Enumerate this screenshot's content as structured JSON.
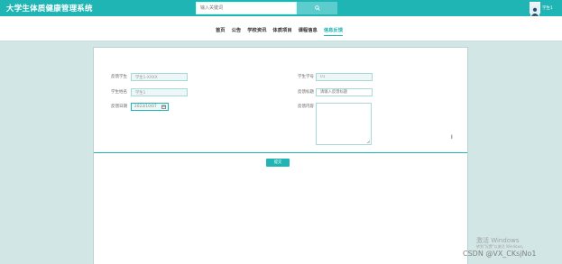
{
  "header": {
    "brand": "大学生体质健康管理系统",
    "search_placeholder": "输入关键词",
    "search_icon": "search-icon",
    "user_name": "学生1",
    "avatar_icon": "user-avatar-icon"
  },
  "nav": {
    "items": [
      {
        "label": "首页"
      },
      {
        "label": "公告"
      },
      {
        "label": "学校资讯"
      },
      {
        "label": "体质项目"
      },
      {
        "label": "课程信息"
      },
      {
        "label": "信息反馈",
        "active": true
      }
    ]
  },
  "form": {
    "left": [
      {
        "label": "反馈学生",
        "value": "学生1-XXXX"
      },
      {
        "label": "学生姓名",
        "value": "学生1"
      },
      {
        "label": "反馈日期",
        "value": "2023/10/07"
      }
    ],
    "right": [
      {
        "label": "学生学号",
        "value": "01"
      },
      {
        "label": "反馈标题",
        "placeholder": "请输入反馈标题"
      },
      {
        "label": "反馈内容",
        "value": ""
      }
    ],
    "submit_label": "提交"
  },
  "watermarks": {
    "windows_title": "激活 Windows",
    "windows_sub": "转到\"设置\"以激活 Windows。",
    "csdn": "CSDN @VX_CKsjNo1"
  },
  "colors": {
    "primary": "#20b5b5",
    "background": "#d3e6e6"
  }
}
